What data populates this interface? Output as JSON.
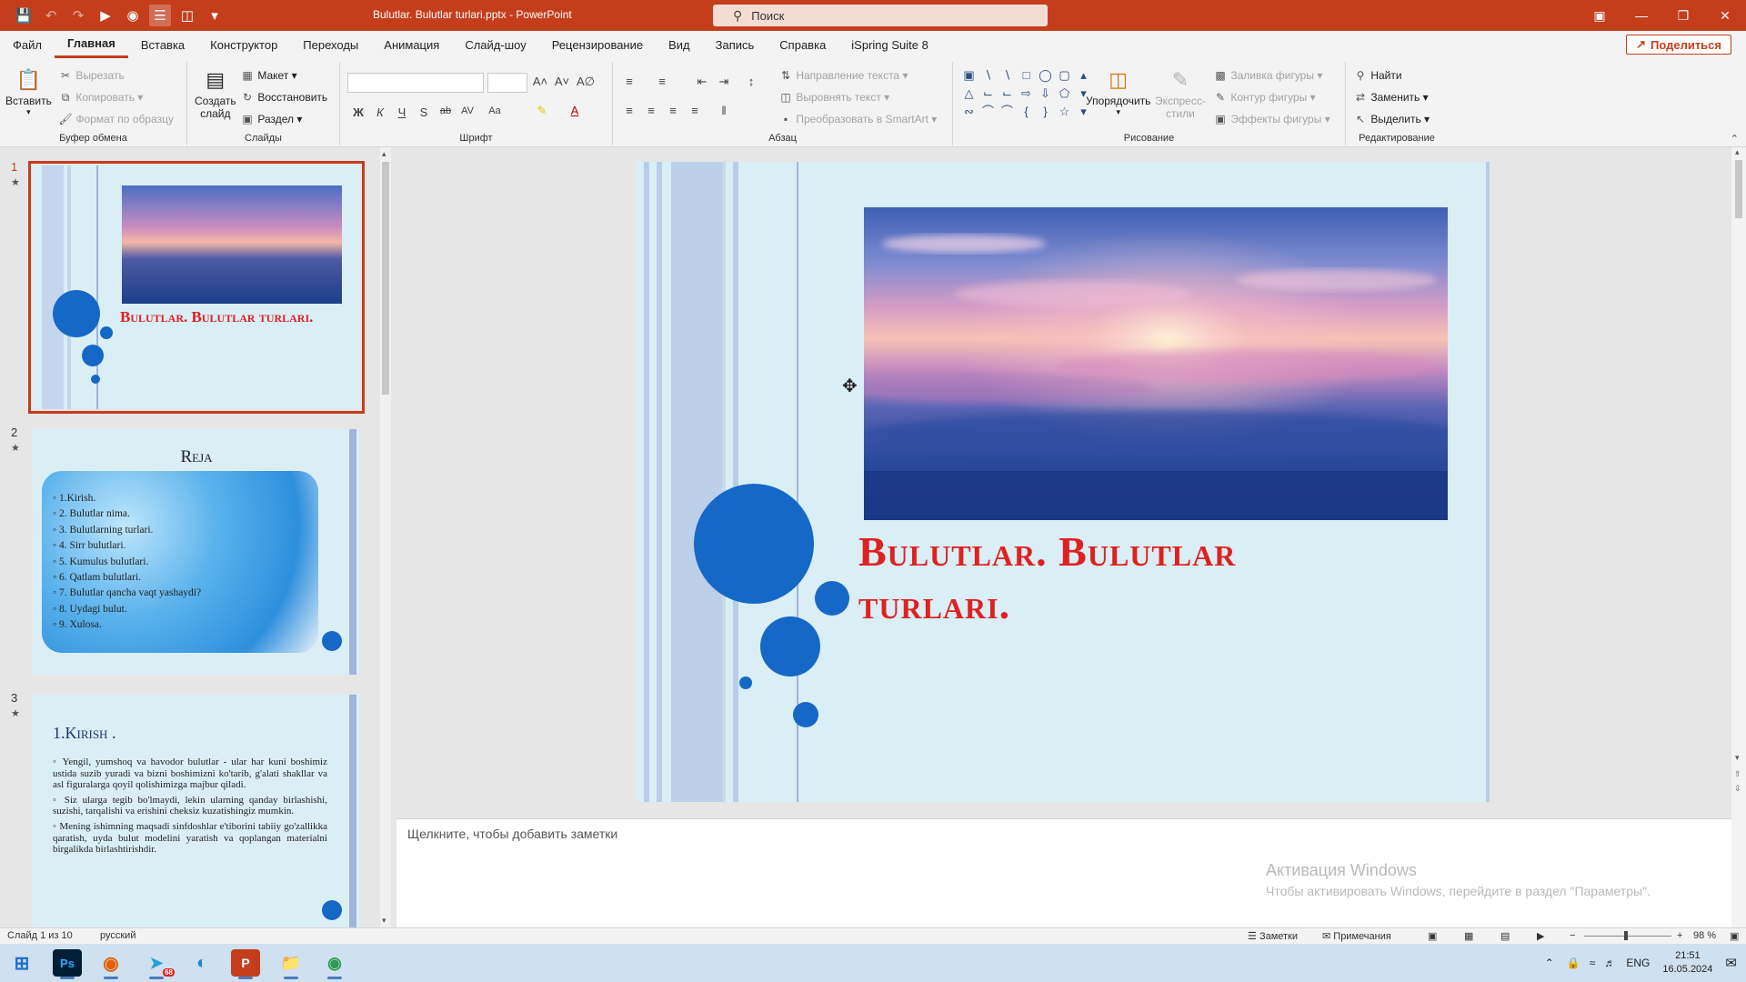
{
  "window": {
    "title": "Bulutlar. Bulutlar turlari.pptx  -  PowerPoint",
    "search_placeholder": "Поиск",
    "colors": {
      "accent": "#c43e1c",
      "slide_bg": "#daeef6",
      "circle": "#1668c7",
      "title_red": "#e02020"
    }
  },
  "menu": {
    "tabs": [
      "Файл",
      "Главная",
      "Вставка",
      "Конструктор",
      "Переходы",
      "Анимация",
      "Слайд-шоу",
      "Рецензирование",
      "Вид",
      "Запись",
      "Справка",
      "iSpring Suite 8"
    ],
    "active_tab": "Главная",
    "share": "Поделиться"
  },
  "ribbon": {
    "clipboard": {
      "paste": "Вставить",
      "cut": "Вырезать",
      "copy": "Копировать",
      "format": "Формат по образцу",
      "label": "Буфер обмена"
    },
    "slides": {
      "new_slide_line1": "Создать",
      "new_slide_line2": "слайд",
      "layout": "Макет",
      "reset": "Восстановить",
      "section": "Раздел",
      "label": "Слайды"
    },
    "font": {
      "label": "Шрифт",
      "buttons": [
        "Ж",
        "К",
        "Ч",
        "S",
        "ab",
        "AV",
        "Aa"
      ]
    },
    "paragraph": {
      "text_direction": "Направление текста",
      "align_text": "Выровнять текст",
      "smartart": "Преобразовать в SmartArt",
      "label": "Абзац"
    },
    "drawing": {
      "arrange": "Упорядочить",
      "quick_styles_line1": "Экспресс-",
      "quick_styles_line2": "стили",
      "fill": "Заливка фигуры",
      "outline": "Контур фигуры",
      "effects": "Эффекты фигуры",
      "label": "Рисование"
    },
    "editing": {
      "find": "Найти",
      "replace": "Заменить",
      "select": "Выделить",
      "label": "Редактирование"
    }
  },
  "thumbnails": [
    {
      "num": "1",
      "title": "Bulutlar. Bulutlar turlari."
    },
    {
      "num": "2",
      "title": "Reja",
      "items": [
        "1.Kirish.",
        "2. Bulutlar nima.",
        "3. Bulutlarning turlari.",
        "4. Sirr bulutlari.",
        "5. Kumulus bulutlari.",
        "6. Qatlam bulutlari.",
        "7. Bulutlar qancha vaqt yashaydi?",
        "8. Uydagi bulut.",
        "9. Xulosa."
      ]
    },
    {
      "num": "3",
      "title": "1.Kirish .",
      "bullets": [
        "Yengil, yumshoq va havodor bulutlar - ular har kuni boshimiz ustida suzib yuradi va bizni boshimizni ko'tarib, g'alati shakllar va asl figuralarga qoyil qolishimizga majbur qiladi.",
        "Siz ularga tegib bo'lmaydi, lekin ularning qanday birlashishi, suzishi, tarqalishi va erishini cheksiz kuzatishingiz mumkin.",
        "Mening ishimning maqsadi sinfdoshlar e'tiborini tabiiy go'zallikka qaratish, uyda bulut modelini yaratish va qoplangan materialni birgalikda birlashtirishdir."
      ]
    }
  ],
  "slide": {
    "title_line1": "Bulutlar. Bulutlar",
    "title_line2": "turlari."
  },
  "notes": {
    "placeholder": "Щелкните, чтобы добавить заметки"
  },
  "activation": {
    "line1": "Активация Windows",
    "line2": "Чтобы активировать Windows, перейдите в раздел \"Параметры\"."
  },
  "status": {
    "slide_of": "Слайд 1 из 10",
    "language": "русский",
    "notes": "Заметки",
    "comments": "Примечания",
    "zoom": "98 %"
  },
  "taskbar": {
    "lang": "ENG",
    "time": "21:51",
    "date": "16.05.2024",
    "telegram_badge": "68"
  }
}
